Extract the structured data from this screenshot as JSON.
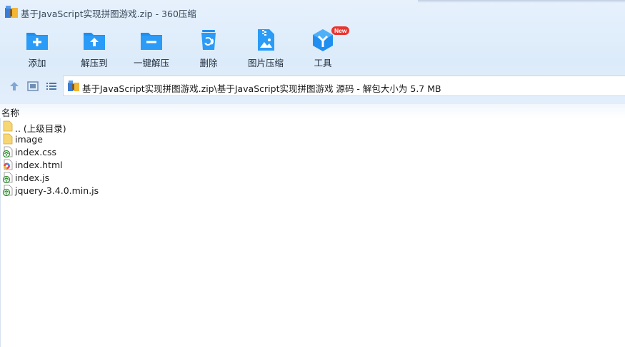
{
  "window": {
    "title": "基于JavaScript实现拼图游戏.zip - 360压缩"
  },
  "toolbar": {
    "add_label": "添加",
    "extract_to_label": "解压到",
    "one_click_extract_label": "一键解压",
    "delete_label": "删除",
    "image_compress_label": "图片压缩",
    "tools_label": "工具",
    "tools_badge": "New"
  },
  "address": {
    "path": "基于JavaScript实现拼图游戏.zip\\基于JavaScript实现拼图游戏 源码 - 解包大小为 5.7 MB"
  },
  "columns": {
    "name": "名称"
  },
  "files": [
    {
      "name": ".. (上级目录)",
      "icon": "folder-icon"
    },
    {
      "name": "image",
      "icon": "folder-icon"
    },
    {
      "name": "index.css",
      "icon": "css-file-icon"
    },
    {
      "name": "index.html",
      "icon": "html-file-icon"
    },
    {
      "name": "index.js",
      "icon": "js-file-icon"
    },
    {
      "name": "jquery-3.4.0.min.js",
      "icon": "js-file-icon"
    }
  ],
  "colors": {
    "accent": "#1f8ef1",
    "badge": "#e8342f",
    "folder": "#f7d774"
  }
}
